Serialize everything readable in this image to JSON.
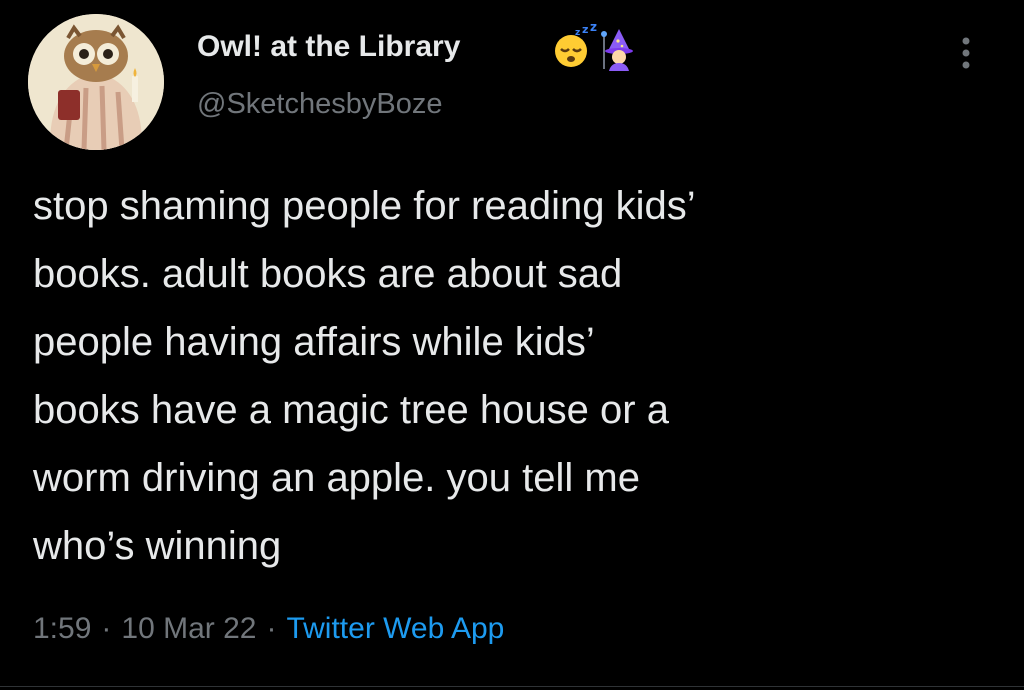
{
  "tweet": {
    "display_name": "Owl! at the Library",
    "name_emojis": [
      "sleeping-face-emoji",
      "mage-emoji"
    ],
    "handle": "@SketchesbyBoze",
    "avatar_icon": "owl-avatar",
    "more_icon": "more-options-icon",
    "text": "stop shaming people for reading kids’\nbooks. adult books are about sad\npeople having affairs while kids’\nbooks have a magic tree house or a\nworm driving an apple. you tell me\nwho’s winning",
    "time": "1:59",
    "separator": "·",
    "date": "10 Mar 22",
    "source": "Twitter Web App"
  },
  "colors": {
    "background": "#000000",
    "primary_text": "#e7e9ea",
    "secondary_text": "#71767b",
    "link": "#1d9bf0"
  }
}
